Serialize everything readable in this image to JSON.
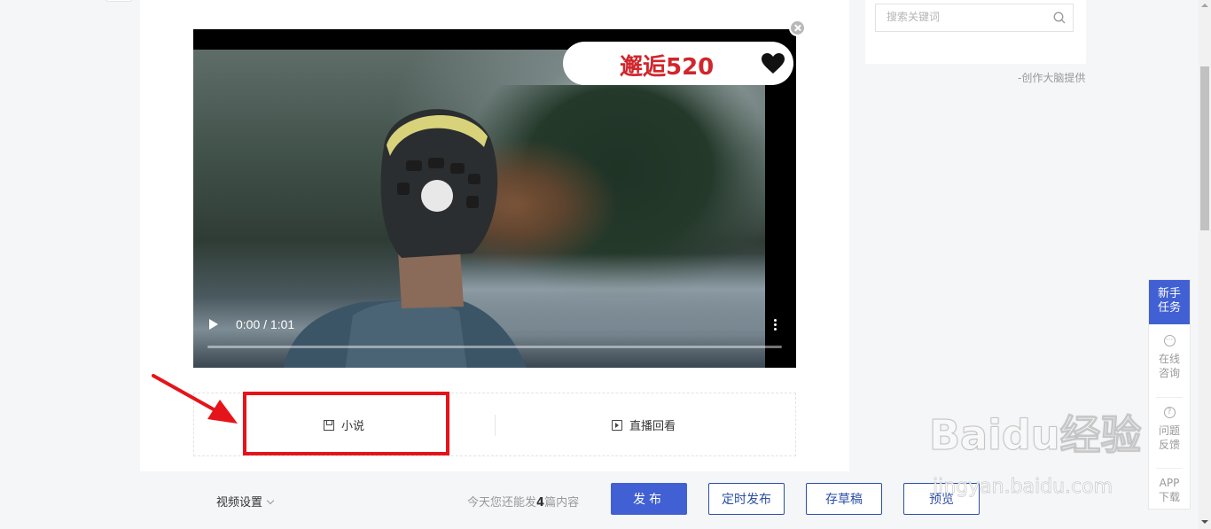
{
  "video": {
    "time": "0:00 / 1:01",
    "sticker_text": "邂逅520"
  },
  "tags": {
    "left": "小说",
    "right": "直播回看"
  },
  "sidebar": {
    "search_placeholder": "搜索关键词",
    "credit": "-创作大脑提供"
  },
  "bottom": {
    "video_settings": "视频设置",
    "quota_prefix": "今天您还能发",
    "quota_count": "4",
    "quota_suffix": "篇内容",
    "publish": "发布",
    "schedule": "定时发布",
    "draft": "存草稿",
    "preview": "预览"
  },
  "float_panel": {
    "new_task_1": "新手",
    "new_task_2": "任务",
    "consult_1": "在线",
    "consult_2": "咨询",
    "feedback_1": "问题",
    "feedback_2": "反馈",
    "app_1": "APP",
    "app_2": "下载"
  },
  "watermark": {
    "logo": "Baidu经验",
    "url": "jingyan.baidu.com"
  },
  "colors": {
    "primary": "#4160d3",
    "highlight": "#e5141a",
    "sticker_text": "#d0262c"
  }
}
